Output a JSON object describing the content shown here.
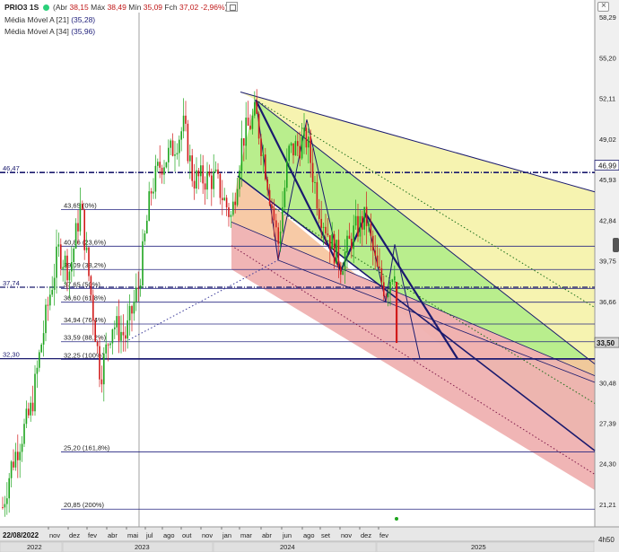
{
  "chart_data": {
    "type": "candlestick",
    "symbol": "PRIO3 1S",
    "quote": {
      "open_label": "Abr",
      "open": "38,15",
      "high_label": "Máx",
      "high": "38,49",
      "low_label": "Mín",
      "low": "35,09",
      "close_label": "Fch",
      "close": "37,02",
      "change": "-2,96%"
    },
    "indicators": [
      {
        "label": "Média Móvel A [21]",
        "value": "(35,28)",
        "color": "#1f1f7a"
      },
      {
        "label": "Média Móvel A [34]",
        "value": "(35,96)",
        "color": "#1f1f7a"
      }
    ],
    "y_axis": {
      "min": 19.5,
      "max": 59.6,
      "ticks": [
        58.29,
        55.2,
        52.11,
        49.02,
        45.93,
        42.84,
        39.75,
        36.66,
        30.48,
        27.39,
        24.3,
        21.21
      ],
      "format": "comma"
    },
    "current_price": {
      "value": 33.5,
      "label": "33,50"
    },
    "price_marker": {
      "value": 46.99,
      "label": "46,99"
    },
    "left_levels": [
      {
        "value": 46.47,
        "label": "46,47"
      },
      {
        "value": 37.74,
        "label": "37,74"
      },
      {
        "value": 32.3,
        "label": "32,30"
      }
    ],
    "fibonacci": [
      {
        "value": 43.65,
        "label": "43,65 (0%)"
      },
      {
        "value": 40.86,
        "label": "40,86 (23,6%)"
      },
      {
        "value": 39.09,
        "label": "39,09 (38,2%)"
      },
      {
        "value": 37.65,
        "label": "37,65 (50%)"
      },
      {
        "value": 36.6,
        "label": "36,60 (61,8%)"
      },
      {
        "value": 34.94,
        "label": "34,94 (76,4%)"
      },
      {
        "value": 33.59,
        "label": "33,59 (88,2%)"
      },
      {
        "value": 32.25,
        "label": "32,25 (100%)"
      },
      {
        "value": 25.2,
        "label": "25,20 (161,8%)"
      },
      {
        "value": 20.85,
        "label": "20,85 (200%)"
      }
    ],
    "x_axis": {
      "start_date": "22/08/2022",
      "months": [
        "nov",
        "dez",
        "fev",
        "abr",
        "mai",
        "jul",
        "ago",
        "out",
        "nov",
        "jan",
        "mar",
        "abr",
        "jun",
        "ago",
        "set",
        "nov",
        "dez",
        "fev"
      ],
      "years": [
        "2022",
        "2023",
        "2024",
        "2025"
      ]
    },
    "timer_label": "4h50",
    "colors": {
      "up": "#1ea51e",
      "down": "#d11a1a",
      "line": "#1a1a6e",
      "yellow_zone": "#f6f3b0",
      "green_zone": "#b9ee8d",
      "orange_zone": "#f6c49c",
      "red_zone": "#efb1b1"
    }
  }
}
